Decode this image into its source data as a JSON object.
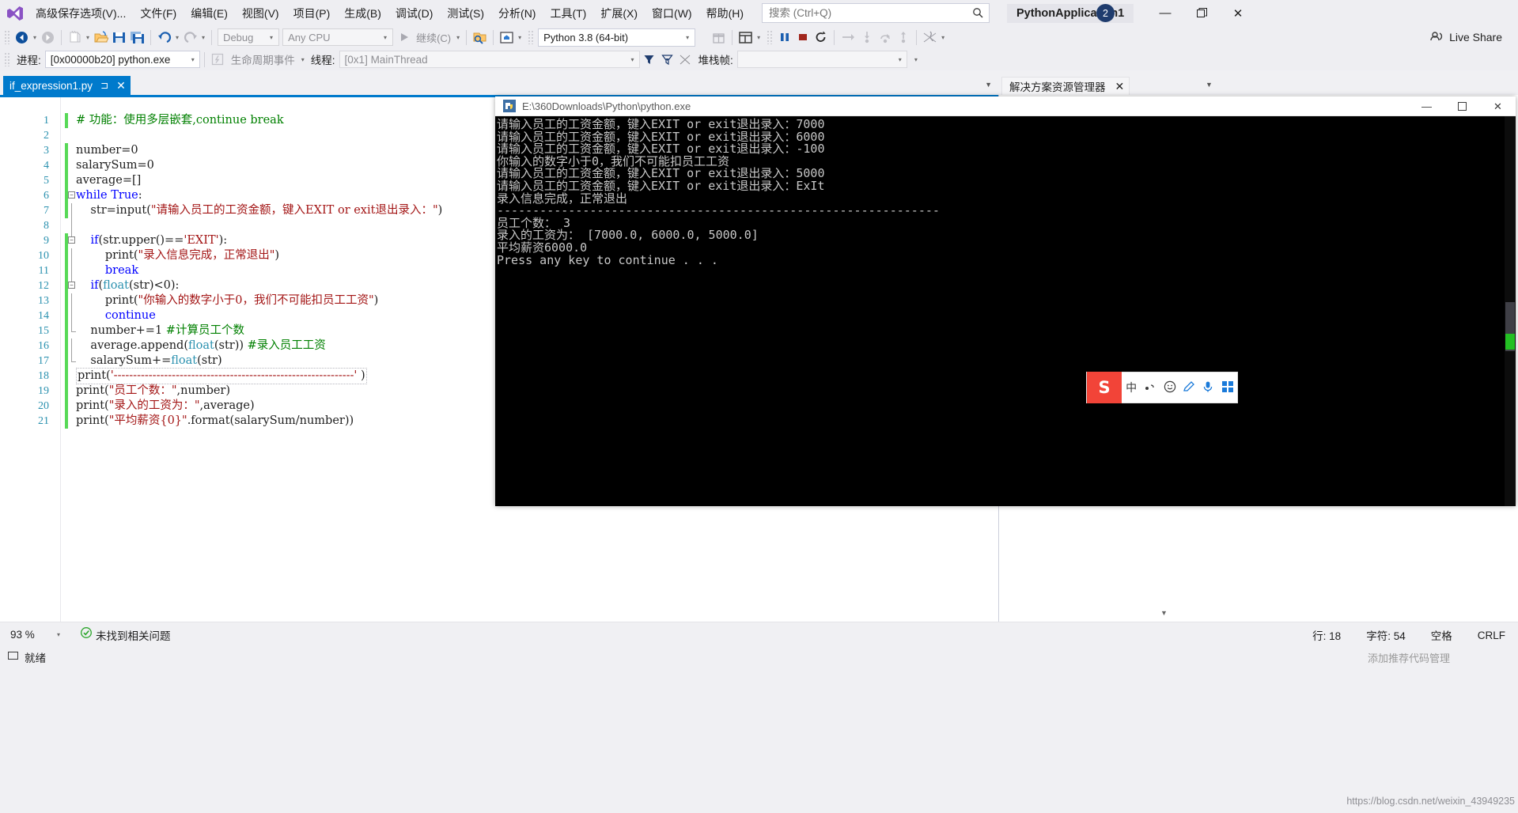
{
  "window": {
    "app_title": "PythonApplication1",
    "notification_count": "2",
    "minimize": "—",
    "maximize": "❐",
    "close": "✕"
  },
  "menu": {
    "logo_icon": "visual-studio-logo",
    "items": [
      "高级保存选项(V)...",
      "文件(F)",
      "编辑(E)",
      "视图(V)",
      "项目(P)",
      "生成(B)",
      "调试(D)",
      "测试(S)",
      "分析(N)",
      "工具(T)",
      "扩展(X)",
      "窗口(W)",
      "帮助(H)"
    ]
  },
  "search": {
    "placeholder": "搜索 (Ctrl+Q)",
    "value": "",
    "icon": "search-icon"
  },
  "live_share": {
    "label": "Live Share",
    "icon": "live-share-icon"
  },
  "toolbar": {
    "nav_back_icon": "navigate-back-icon",
    "nav_forward_icon": "navigate-forward-icon",
    "new_project_icon": "new-project-icon",
    "open_file_icon": "open-file-icon",
    "save_icon": "save-icon",
    "save_all_icon": "save-all-icon",
    "undo_icon": "undo-icon",
    "redo_icon": "redo-icon",
    "config_combo": "Debug",
    "platform_combo": "Any CPU",
    "continue_label": "继续(C)",
    "continue_icon": "play-icon",
    "attach_icon": "attach-to-process-icon",
    "browser_icon": "web-browser-icon",
    "interpreter_combo": "Python 3.8 (64-bit)",
    "gift_icon": "gift-icon",
    "layout_icon": "window-layout-icon",
    "pause_icon": "pause-icon",
    "stop_icon": "stop-icon",
    "restart_icon": "restart-icon",
    "step_over_icon": "step-over-icon",
    "step_into_icon": "step-into-icon",
    "step_out_icon": "step-out-icon",
    "step_next_icon": "step-next-icon",
    "hot_reload_icon": "hot-reload-icon"
  },
  "debugbar": {
    "process_label": "进程:",
    "process_value": "[0x00000b20] python.exe",
    "lifecycle_icon": "lifecycle-events-icon",
    "lifecycle_label": "生命周期事件",
    "thread_label": "线程:",
    "thread_value": "[0x1] MainThread",
    "filter_icon": "filter-icon",
    "filter_down_icon": "filter-down-icon",
    "flag_icon": "flag-icon",
    "stackframe_label": "堆栈帧:",
    "stackframe_value": ""
  },
  "editor_tabs": {
    "active_tab": "if_expression1.py",
    "pin_icon": "pin-icon",
    "close_icon": "close-icon",
    "overflow_icon": "chevron-down-icon"
  },
  "solution_explorer": {
    "tab_label": "解决方案资源管理器",
    "close_icon": "close-icon",
    "overflow_icon": "chevron-down-icon"
  },
  "code": {
    "lines": [
      {
        "n": "1",
        "changed": true,
        "fold": "none",
        "indent": 0,
        "tokens": [
          {
            "t": "# 功能：使用多层嵌套,continue break",
            "c": "cmt"
          }
        ]
      },
      {
        "n": "2",
        "changed": false,
        "fold": "none",
        "indent": 0,
        "tokens": []
      },
      {
        "n": "3",
        "changed": true,
        "fold": "none",
        "indent": 0,
        "tokens": [
          {
            "t": "number=0",
            "c": "op"
          }
        ]
      },
      {
        "n": "4",
        "changed": true,
        "fold": "none",
        "indent": 0,
        "tokens": [
          {
            "t": "salarySum=0",
            "c": "op"
          }
        ]
      },
      {
        "n": "5",
        "changed": true,
        "fold": "none",
        "indent": 0,
        "tokens": [
          {
            "t": "average=[]",
            "c": "op"
          }
        ]
      },
      {
        "n": "6",
        "changed": true,
        "fold": "collapse",
        "indent": 0,
        "tokens": [
          {
            "t": "while",
            "c": "kw"
          },
          {
            "t": " ",
            "c": "op"
          },
          {
            "t": "True",
            "c": "kw"
          },
          {
            "t": ":",
            "c": "op"
          }
        ]
      },
      {
        "n": "7",
        "changed": true,
        "fold": "line",
        "indent": 0,
        "tokens": [
          {
            "t": "    str=input(",
            "c": "op"
          },
          {
            "t": "\"请输入员工的工资金额，键入EXIT or exit退出录入：\"",
            "c": "str"
          },
          {
            "t": ")",
            "c": "op"
          }
        ]
      },
      {
        "n": "8",
        "changed": false,
        "fold": "line",
        "indent": 0,
        "tokens": []
      },
      {
        "n": "9",
        "changed": true,
        "fold": "collapse2",
        "indent": 0,
        "tokens": [
          {
            "t": "    ",
            "c": "op"
          },
          {
            "t": "if",
            "c": "kw"
          },
          {
            "t": "(str.upper()==",
            "c": "op"
          },
          {
            "t": "'EXIT'",
            "c": "str"
          },
          {
            "t": "):",
            "c": "op"
          }
        ]
      },
      {
        "n": "10",
        "changed": true,
        "fold": "line2",
        "indent": 0,
        "tokens": [
          {
            "t": "        print(",
            "c": "op"
          },
          {
            "t": "\"录入信息完成，正常退出\"",
            "c": "str"
          },
          {
            "t": ")",
            "c": "op"
          }
        ]
      },
      {
        "n": "11",
        "changed": true,
        "fold": "line2",
        "indent": 0,
        "tokens": [
          {
            "t": "        ",
            "c": "op"
          },
          {
            "t": "break",
            "c": "kw"
          }
        ]
      },
      {
        "n": "12",
        "changed": true,
        "fold": "collapse3",
        "indent": 0,
        "tokens": [
          {
            "t": "    ",
            "c": "op"
          },
          {
            "t": "if",
            "c": "kw"
          },
          {
            "t": "(",
            "c": "op"
          },
          {
            "t": "float",
            "c": "bi"
          },
          {
            "t": "(str)<0):",
            "c": "op"
          }
        ]
      },
      {
        "n": "13",
        "changed": true,
        "fold": "line2",
        "indent": 0,
        "tokens": [
          {
            "t": "        print(",
            "c": "op"
          },
          {
            "t": "\"你输入的数字小于0，我们不可能扣员工工资\"",
            "c": "str"
          },
          {
            "t": ")",
            "c": "op"
          }
        ]
      },
      {
        "n": "14",
        "changed": true,
        "fold": "line2",
        "indent": 0,
        "tokens": [
          {
            "t": "        ",
            "c": "op"
          },
          {
            "t": "continue",
            "c": "kw"
          }
        ]
      },
      {
        "n": "15",
        "changed": true,
        "fold": "endline",
        "indent": 0,
        "tokens": [
          {
            "t": "    number+=1 ",
            "c": "op"
          },
          {
            "t": "#计算员工个数",
            "c": "cmt"
          }
        ]
      },
      {
        "n": "16",
        "changed": true,
        "fold": "line",
        "indent": 0,
        "tokens": [
          {
            "t": "    average.append(",
            "c": "op"
          },
          {
            "t": "float",
            "c": "bi"
          },
          {
            "t": "(str)) ",
            "c": "op"
          },
          {
            "t": "#录入员工工资",
            "c": "cmt"
          }
        ]
      },
      {
        "n": "17",
        "changed": true,
        "fold": "lineend",
        "indent": 0,
        "tokens": [
          {
            "t": "    salarySum+=",
            "c": "op"
          },
          {
            "t": "float",
            "c": "bi"
          },
          {
            "t": "(str)",
            "c": "op"
          }
        ]
      },
      {
        "n": "18",
        "changed": true,
        "fold": "none",
        "indent": 0,
        "selected": true,
        "tokens": [
          {
            "t": "print(",
            "c": "op"
          },
          {
            "t": "'--------------------------------------------------------------'",
            "c": "str"
          },
          {
            "t": " )",
            "c": "op"
          }
        ]
      },
      {
        "n": "19",
        "changed": true,
        "fold": "none",
        "indent": 0,
        "tokens": [
          {
            "t": "print(",
            "c": "op"
          },
          {
            "t": "\"员工个数：\"",
            "c": "str"
          },
          {
            "t": ",number)",
            "c": "op"
          }
        ]
      },
      {
        "n": "20",
        "changed": true,
        "fold": "none",
        "indent": 0,
        "tokens": [
          {
            "t": "print(",
            "c": "op"
          },
          {
            "t": "\"录入的工资为：\"",
            "c": "str"
          },
          {
            "t": ",average)",
            "c": "op"
          }
        ]
      },
      {
        "n": "21",
        "changed": true,
        "fold": "none",
        "indent": 0,
        "tokens": [
          {
            "t": "print(",
            "c": "op"
          },
          {
            "t": "\"平均薪资{0}\"",
            "c": "str"
          },
          {
            "t": ".format(salarySum/number))",
            "c": "op"
          }
        ]
      }
    ]
  },
  "console": {
    "title": "E:\\360Downloads\\Python\\python.exe",
    "icon": "python-exe-icon",
    "minimize": "—",
    "maximize": "❐",
    "close": "✕",
    "output": "请输入员工的工资金额，键入EXIT or exit退出录入：7000\n请输入员工的工资金额，键入EXIT or exit退出录入：6000\n请输入员工的工资金额，键入EXIT or exit退出录入：-100\n你输入的数字小于0，我们不可能扣员工工资\n请输入员工的工资金额，键入EXIT or exit退出录入：5000\n请输入员工的工资金额，键入EXIT or exit退出录入：ExIt\n录入信息完成，正常退出\n--------------------------------------------------------------\n员工个数： 3\n录入的工资为： [7000.0, 6000.0, 5000.0]\n平均薪资6000.0\nPress any key to continue . . ."
  },
  "ime": {
    "logo": "S",
    "mode_label": "中",
    "punct_icon": "half-width-icon",
    "emoji_icon": "emoji-icon",
    "pen_icon": "handwriting-icon",
    "mic_icon": "microphone-icon",
    "menu_icon": "toolbox-icon"
  },
  "statusbar": {
    "zoom": "93 %",
    "error_icon": "check-ok-icon",
    "error_text": "未找到相关问题",
    "line_label": "行: 18",
    "col_label": "字符: 54",
    "insert_label": "空格",
    "eol_label": "CRLF",
    "ready_icon": "ready-icon",
    "ready_text": "就绪",
    "watermark": "添加推荐代码管理",
    "watermark_url": "https://blog.csdn.net/weixin_43949235"
  }
}
